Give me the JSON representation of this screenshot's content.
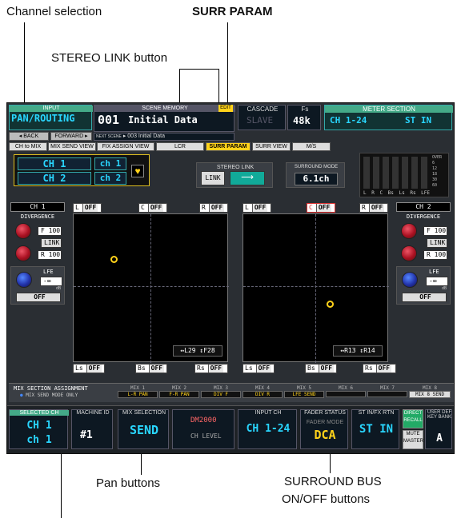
{
  "callouts": {
    "channel_selection": "Channel selection",
    "surr_param": "SURR PARAM",
    "stereo_link_button": "STEREO LINK button",
    "pan_buttons": "Pan buttons",
    "surround_bus_line1": "SURROUND BUS",
    "surround_bus_line2": "ON/OFF buttons"
  },
  "header": {
    "input_label": "INPUT",
    "function_title": "PAN/ROUTING",
    "back": "BACK",
    "forward": "FORWARD",
    "scene_memory_label": "SCENE MEMORY",
    "edit_badge": "EDIT",
    "scene_number": "001",
    "scene_name": "Initial Data",
    "next_scene_label": "NEXT SCENE",
    "next_scene": "003 Initial Data",
    "cascade_label": "CASCADE",
    "cascade_value": "SLAVE",
    "fs_label": "Fs",
    "fs_value": "48k",
    "meter_section_label": "METER SECTION",
    "meter_ch": "CH 1-24",
    "meter_st": "ST IN"
  },
  "tabs": [
    "CH to MIX",
    "MIX SEND VIEW",
    "FIX ASSIGN VIEW",
    "LCR",
    "SURR PARAM",
    "SURR VIEW",
    "M/S"
  ],
  "channels": {
    "ch1": "CH 1",
    "ch2": "CH 2",
    "name1": "ch 1",
    "name2": "ch 2"
  },
  "stereo_link": {
    "label": "STEREO LINK",
    "link_button": "LINK"
  },
  "surround_mode": {
    "label": "SURROUND MODE",
    "value": "6.1ch"
  },
  "meter_scale": [
    "OVER",
    "6",
    "12",
    "18",
    "30",
    "60"
  ],
  "meter_labels": "L R C Bs Ls Rs LFE",
  "left_strip": {
    "title": "CH 1",
    "divergence": "DIVERGENCE",
    "f_label": "F",
    "f_value": "100",
    "link": "LINK",
    "r_label": "R",
    "r_value": "100",
    "lfe_label": "LFE",
    "lfe_value": "-∞",
    "db": "dB",
    "off_button": "OFF"
  },
  "right_strip": {
    "title": "CH 2",
    "divergence": "DIVERGENCE",
    "f_label": "F",
    "f_value": "100",
    "link": "LINK",
    "r_label": "R",
    "r_value": "100",
    "lfe_label": "LFE",
    "lfe_value": "-∞",
    "db": "dB",
    "off_button": "OFF"
  },
  "pan_panel_1": {
    "top_buttons": [
      {
        "name": "L",
        "state": "OFF"
      },
      {
        "name": "C",
        "state": "OFF"
      },
      {
        "name": "R",
        "state": "OFF"
      }
    ],
    "bottom_buttons": [
      {
        "name": "Ls",
        "state": "OFF"
      },
      {
        "name": "Bs",
        "state": "OFF"
      },
      {
        "name": "Rs",
        "state": "OFF"
      }
    ],
    "readout": "↔L29 ↕F28"
  },
  "pan_panel_2": {
    "top_buttons": [
      {
        "name": "L",
        "state": "OFF"
      },
      {
        "name": "C",
        "state": "OFF"
      },
      {
        "name": "R",
        "state": "OFF"
      }
    ],
    "bottom_buttons": [
      {
        "name": "Ls",
        "state": "OFF"
      },
      {
        "name": "Bs",
        "state": "OFF"
      },
      {
        "name": "Rs",
        "state": "OFF"
      }
    ],
    "readout": "↔R13 ↕R14"
  },
  "mix_assign": {
    "title": "MIX SECTION ASSIGNMENT",
    "mode": "MIX SEND MODE ONLY",
    "slots": [
      {
        "mix": "MIX 1",
        "val": "L-R PAN"
      },
      {
        "mix": "MIX 2",
        "val": "F-R PAN"
      },
      {
        "mix": "MIX 3",
        "val": "DIV F"
      },
      {
        "mix": "MIX 4",
        "val": "DIV R"
      },
      {
        "mix": "MIX 5",
        "val": "LFE SEND"
      },
      {
        "mix": "MIX 6",
        "val": ""
      },
      {
        "mix": "MIX 7",
        "val": ""
      },
      {
        "mix": "MIX 8",
        "val": "MIX 8 SEND"
      }
    ]
  },
  "bottom": {
    "selected_ch_label": "SELECTED CH",
    "selected_ch": "CH 1",
    "selected_name": "ch 1",
    "machine_id_label": "MACHINE ID",
    "machine_id": "#1",
    "mix_selection_label": "MIX SELECTION",
    "mix_selection": "SEND",
    "model": "DM2000",
    "ch_level": "CH LEVEL",
    "input_ch_label": "INPUT CH",
    "input_ch": "CH 1-24",
    "fader_status_label": "FADER STATUS",
    "fader_mode": "FADER MODE",
    "fader_value": "DCA",
    "st_in_label": "ST IN/FX RTN",
    "st_in": "ST IN",
    "direct_recall": "DIRECT RECALL",
    "mute_master": "MUTE MASTER",
    "user_def_label": "USER DEF KEY BANK",
    "user_def": "A"
  }
}
